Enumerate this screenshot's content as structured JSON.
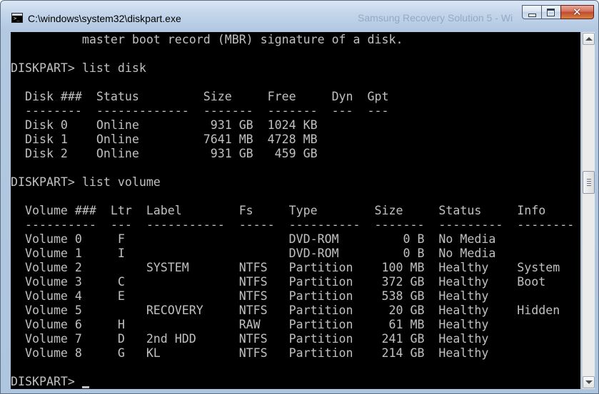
{
  "window": {
    "title": "C:\\windows\\system32\\diskpart.exe",
    "background_title": "Samsung Recovery Solution 5 - Wi",
    "colors": {
      "console_bg": "#000000",
      "console_text": "#c0c0c0",
      "frame": "#b3c9e2",
      "close_button": "#c04a31"
    }
  },
  "controls": {
    "minimize_icon": "minimize-icon",
    "maximize_icon": "maximize-icon",
    "close_icon": "close-icon",
    "close_glyph": "✕"
  },
  "console": {
    "lines": [
      "          master boot record (MBR) signature of a disk.",
      "",
      "DISKPART> list disk",
      "",
      "  Disk ###  Status         Size     Free     Dyn  Gpt",
      "  --------  -------------  -------  -------  ---  ---",
      "  Disk 0    Online          931 GB  1024 KB",
      "  Disk 1    Online         7641 MB  4728 MB",
      "  Disk 2    Online          931 GB   459 GB",
      "",
      "DISKPART> list volume",
      "",
      "  Volume ###  Ltr  Label        Fs     Type        Size     Status     Info",
      "  ----------  ---  -----------  -----  ----------  -------  ---------  --------",
      "  Volume 0     F                       DVD-ROM         0 B  No Media",
      "  Volume 1     I                       DVD-ROM         0 B  No Media",
      "  Volume 2         SYSTEM       NTFS   Partition    100 MB  Healthy    System",
      "  Volume 3     C                NTFS   Partition    372 GB  Healthy    Boot",
      "  Volume 4     E                NTFS   Partition    538 GB  Healthy",
      "  Volume 5         RECOVERY     NTFS   Partition     20 GB  Healthy    Hidden",
      "  Volume 6     H                RAW    Partition     61 MB  Healthy",
      "  Volume 7     D   2nd HDD      NTFS   Partition    241 GB  Healthy",
      "  Volume 8     G   KL           NTFS   Partition    214 GB  Healthy",
      "",
      "DISKPART> "
    ]
  },
  "scrollbar": {
    "up_icon": "scroll-up-arrow-icon",
    "down_icon": "scroll-down-arrow-icon",
    "position_fraction": 0.41
  }
}
